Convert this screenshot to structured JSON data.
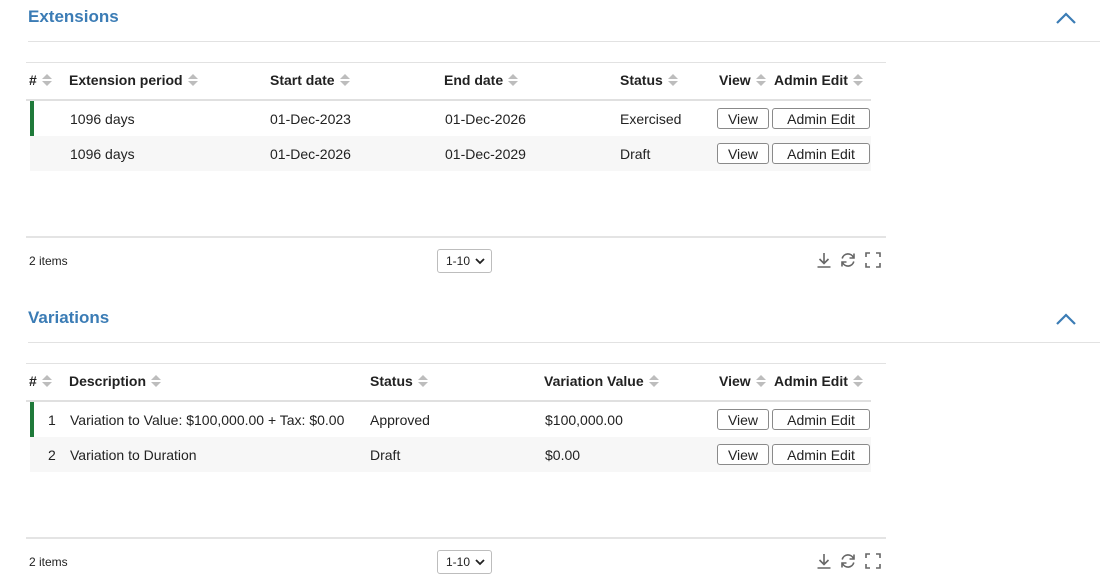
{
  "extensions": {
    "title": "Extensions",
    "columns": [
      "#",
      "Extension period",
      "Start date",
      "End date",
      "Status",
      "View",
      "Admin Edit"
    ],
    "rows": [
      {
        "period": "1096 days",
        "start": "01-Dec-2023",
        "end": "01-Dec-2026",
        "status": "Exercised",
        "view": "View",
        "admin": "Admin Edit"
      },
      {
        "period": "1096 days",
        "start": "01-Dec-2026",
        "end": "01-Dec-2029",
        "status": "Draft",
        "view": "View",
        "admin": "Admin Edit"
      }
    ],
    "count": "2 items",
    "page_size": "1-10"
  },
  "variations": {
    "title": "Variations",
    "columns": [
      "#",
      "Description",
      "Status",
      "Variation Value",
      "View",
      "Admin Edit"
    ],
    "rows": [
      {
        "num": "1",
        "description": "Variation to Value: $100,000.00 + Tax: $0.00",
        "status": "Approved",
        "value": "$100,000.00",
        "view": "View",
        "admin": "Admin Edit"
      },
      {
        "num": "2",
        "description": "Variation to Duration",
        "status": "Draft",
        "value": "$0.00",
        "view": "View",
        "admin": "Admin Edit"
      }
    ],
    "count": "2 items",
    "page_size": "1-10"
  },
  "colors": {
    "accent": "#3b7cb5",
    "selected_marker": "#1f7a3a"
  },
  "icons": [
    "chevron-up-icon",
    "sort-icon",
    "download-icon",
    "refresh-icon",
    "fullscreen-icon",
    "chevron-down-icon"
  ]
}
